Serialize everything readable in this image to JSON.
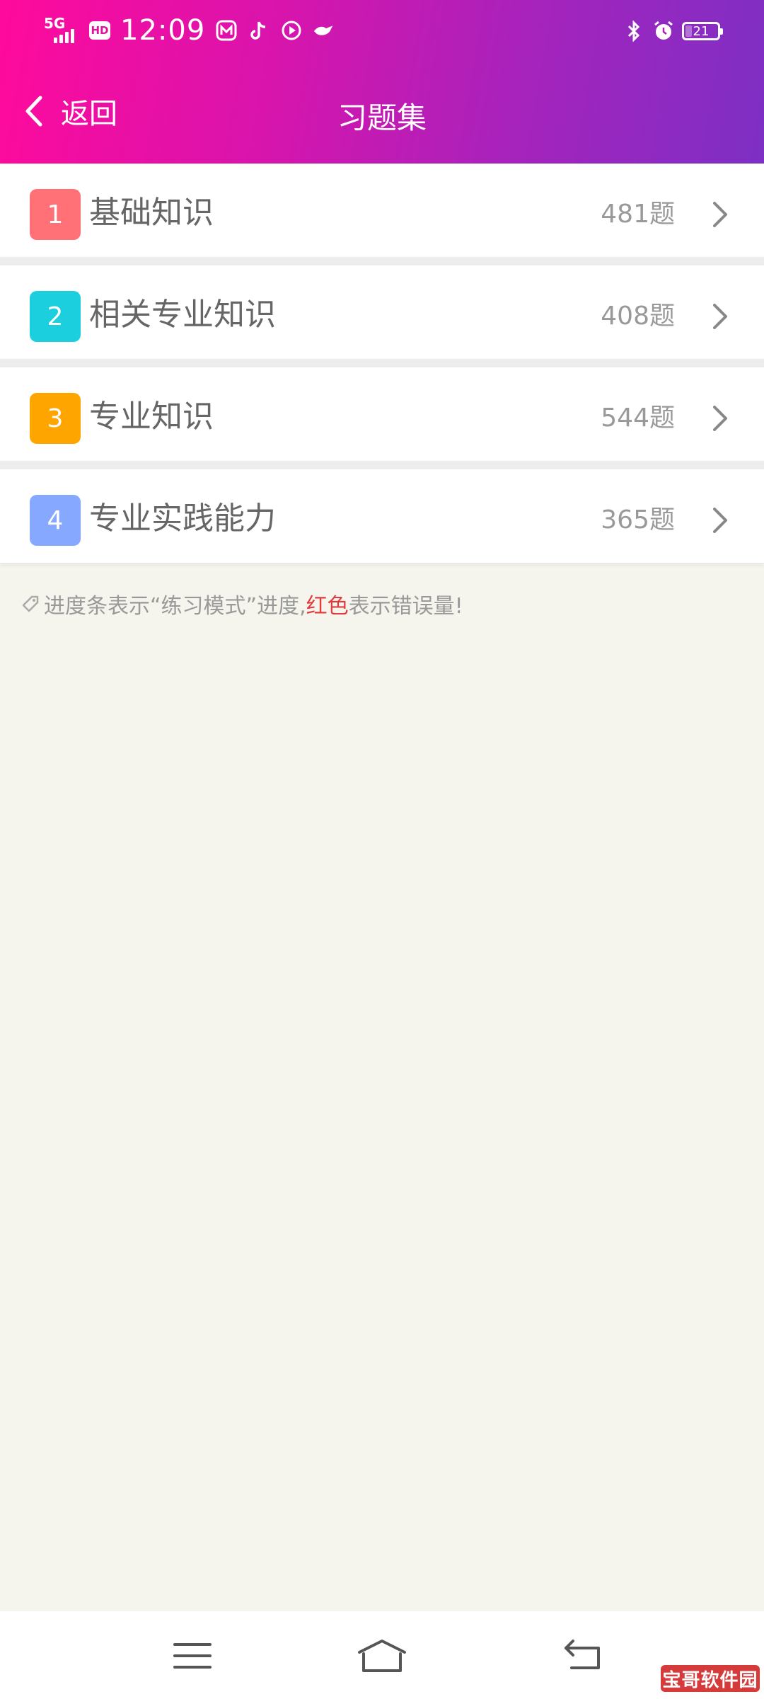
{
  "status_bar": {
    "network": "5G",
    "hd": "HD",
    "time": "12:09",
    "battery": "21",
    "battery_level": 0.21
  },
  "header": {
    "back_label": "返回",
    "title": "习题集"
  },
  "items": [
    {
      "number": "1",
      "label": "基础知识",
      "count": "481题",
      "color": "#ff7077"
    },
    {
      "number": "2",
      "label": "相关专业知识",
      "count": "408题",
      "color": "#1ccfdf"
    },
    {
      "number": "3",
      "label": "专业知识",
      "count": "544题",
      "color": "#ffa500"
    },
    {
      "number": "4",
      "label": "专业实践能力",
      "count": "365题",
      "color": "#86a8ff"
    }
  ],
  "hint": {
    "prefix": "进度条表示“练习模式”进度,",
    "red": "红色",
    "suffix": "表示错误量!"
  },
  "watermark": "宝哥软件园",
  "icons": {
    "back": "chevron-left-icon",
    "item_arrow": "chevron-right-icon",
    "hint": "tag-icon",
    "nav_menu": "menu-icon",
    "nav_home": "home-icon",
    "nav_back": "back-icon"
  },
  "colors": {
    "header_start": "#ff0a9c",
    "header_end": "#7d2fc4",
    "background": "#f6f5ed",
    "red_text": "#e23b3b"
  }
}
